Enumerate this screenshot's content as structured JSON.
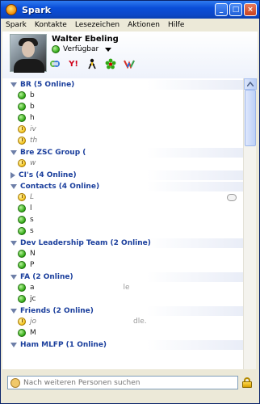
{
  "window": {
    "title": "Spark"
  },
  "menu": [
    "Spark",
    "Kontakte",
    "Lesezeichen",
    "Aktionen",
    "Hilfe"
  ],
  "user": {
    "name": "Walter Ebeling",
    "status": "Verfügbar"
  },
  "groups": [
    {
      "name": "BR (5 Online)",
      "expanded": true,
      "contacts": [
        {
          "name": "b",
          "status": "available"
        },
        {
          "name": "b",
          "status": "available"
        },
        {
          "name": "h",
          "status": "available"
        },
        {
          "name": "iv",
          "status": "idle"
        },
        {
          "name": "th",
          "status": "idle"
        }
      ]
    },
    {
      "name": "Bre ZSC Group (",
      "expanded": true,
      "contacts": [
        {
          "name": "w",
          "status": "idle"
        }
      ]
    },
    {
      "name": "CI's (4 Online)",
      "expanded": false,
      "contacts": []
    },
    {
      "name": "Contacts (4 Online)",
      "expanded": true,
      "contacts": [
        {
          "name": "L",
          "status": "idle"
        },
        {
          "name": "l",
          "status": "available"
        },
        {
          "name": "s",
          "status": "available"
        },
        {
          "name": "s",
          "status": "available"
        }
      ]
    },
    {
      "name": "Dev Leadership Team (2 Online)",
      "expanded": true,
      "contacts": [
        {
          "name": "N",
          "status": "available"
        },
        {
          "name": "P",
          "status": "available"
        }
      ]
    },
    {
      "name": "FA (2 Online)",
      "expanded": true,
      "contacts": [
        {
          "name": "a",
          "status": "available",
          "note": "le"
        },
        {
          "name": "jc",
          "status": "available"
        }
      ]
    },
    {
      "name": "Friends (2 Online)",
      "expanded": true,
      "contacts": [
        {
          "name": "jo",
          "status": "idle",
          "note": "dle."
        },
        {
          "name": "M",
          "status": "available"
        }
      ]
    },
    {
      "name": "Ham MLFP (1 Online)",
      "expanded": true,
      "contacts": []
    }
  ],
  "search": {
    "placeholder": "Nach weiteren Personen suchen"
  }
}
